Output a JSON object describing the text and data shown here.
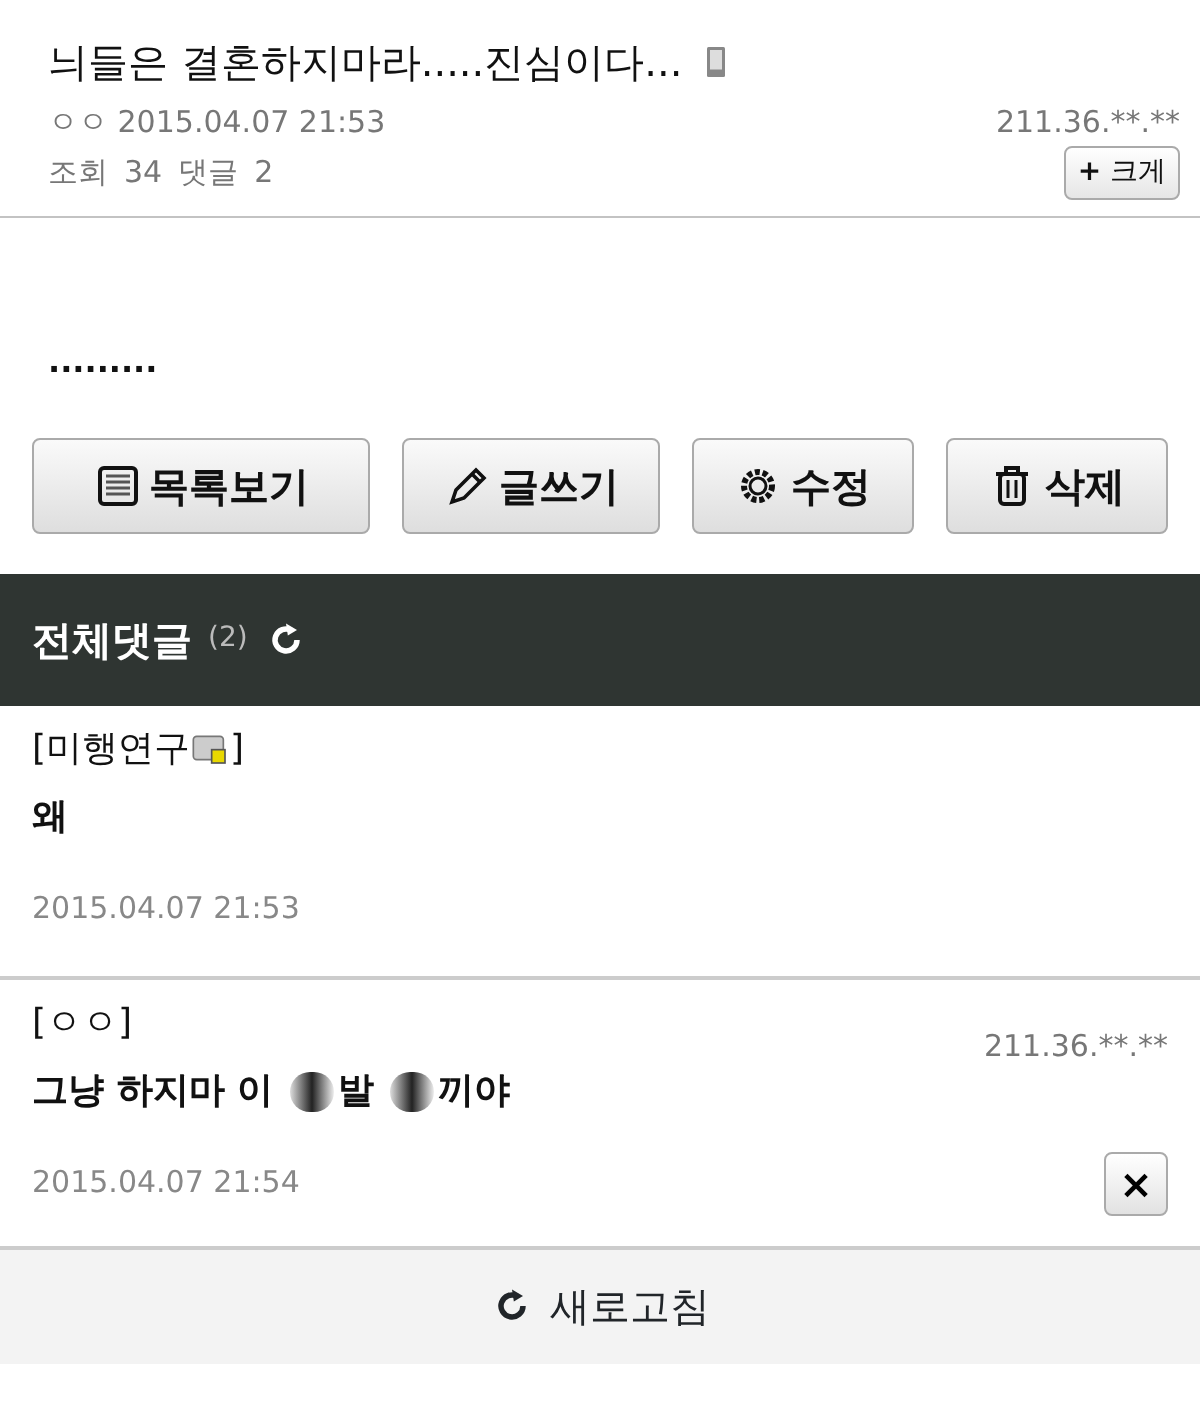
{
  "post": {
    "title": "늬들은 결혼하지마라.....진심이다...",
    "author": "ㅇㅇ",
    "date": "2015.04.07 21:53",
    "ip": "211.36.**.**",
    "views_label": "조회",
    "views": "34",
    "comments_label": "댓글",
    "comments": "2",
    "zoom_button": {
      "icon": "+",
      "label": "크게"
    },
    "body": "........."
  },
  "actions": [
    {
      "kind": "list",
      "label": "목록보기"
    },
    {
      "kind": "write",
      "label": "글쓰기"
    },
    {
      "kind": "edit",
      "label": "수정"
    },
    {
      "kind": "delete",
      "label": "삭제"
    }
  ],
  "comments_header": {
    "title": "전체댓글",
    "count": "(2)"
  },
  "comments": [
    {
      "author": "[미행연구",
      "author_end": "]",
      "badge": true,
      "body": [
        {
          "kind": "text",
          "text": "왜"
        }
      ],
      "date": "2015.04.07 21:53",
      "deletable": false
    },
    {
      "author": "[ㅇㅇ]",
      "badge": false,
      "ip": "211.36.**.**",
      "body": [
        {
          "kind": "text",
          "text": "그냥 하지마 이"
        },
        {
          "kind": "censor"
        },
        {
          "kind": "text",
          "text": "발"
        },
        {
          "kind": "censor"
        },
        {
          "kind": "text",
          "text": "끼야"
        }
      ],
      "date": "2015.04.07 21:54",
      "deletable": true,
      "delete_icon": "×"
    }
  ],
  "refresh": {
    "label": "새로고침"
  }
}
